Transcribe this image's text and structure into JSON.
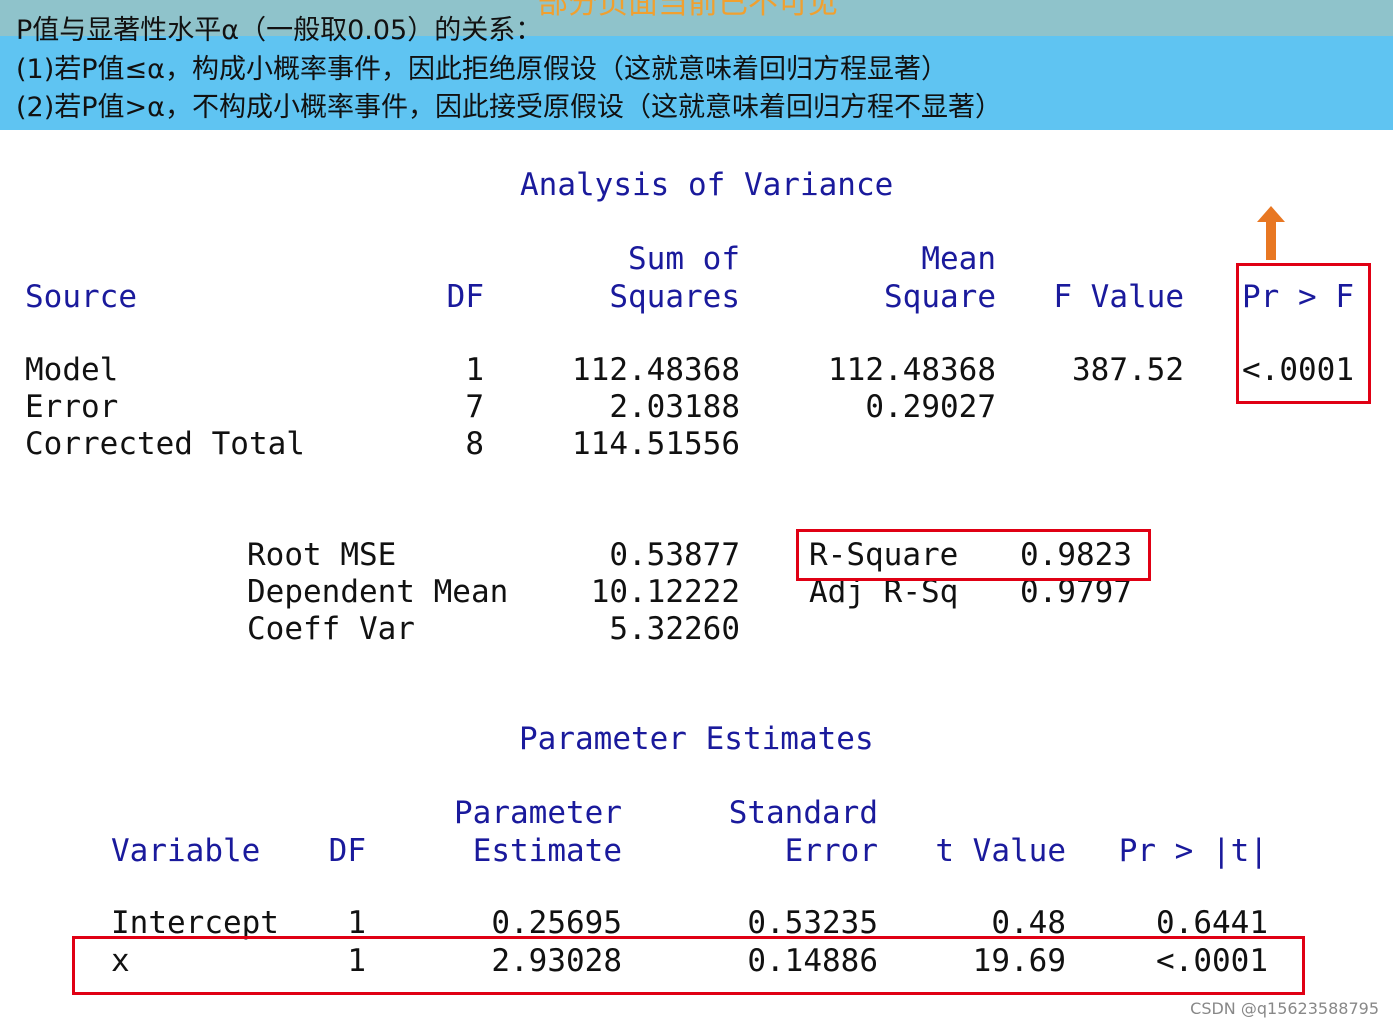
{
  "banner": {
    "clipped_heading": "部分页面当前已不可见",
    "line1": "P值与显著性水平α（一般取0.05）的关系：",
    "line2": "(1)若P值≤α，构成小概率事件，因此拒绝原假设（这就意味着回归方程显著）",
    "line3": "(2)若P值>α，不构成小概率事件，因此接受原假设（这就意味着回归方程不显著）"
  },
  "anova": {
    "title": "Analysis of Variance",
    "headers": {
      "source": "Source",
      "df": "DF",
      "ss_top": "Sum of",
      "ss_bottom": "Squares",
      "ms_top": "Mean",
      "ms_bottom": "Square",
      "f": "F Value",
      "p": "Pr > F"
    },
    "rows": [
      {
        "source": "Model",
        "df": "1",
        "ss": "112.48368",
        "ms": "112.48368",
        "f": "387.52",
        "p": "<.0001"
      },
      {
        "source": "Error",
        "df": "7",
        "ss": "2.03188",
        "ms": "0.29027",
        "f": "",
        "p": ""
      },
      {
        "source": "Corrected Total",
        "df": "8",
        "ss": "114.51556",
        "ms": "",
        "f": "",
        "p": ""
      }
    ]
  },
  "fit": {
    "left": [
      {
        "label": "Root MSE",
        "value": "0.53877"
      },
      {
        "label": "Dependent Mean",
        "value": "10.12222"
      },
      {
        "label": "Coeff Var",
        "value": "5.32260"
      }
    ],
    "right": [
      {
        "label": "R-Square",
        "value": "0.9823"
      },
      {
        "label": "Adj R-Sq",
        "value": "0.9797"
      }
    ]
  },
  "params": {
    "title": "Parameter Estimates",
    "headers": {
      "variable": "Variable",
      "df": "DF",
      "est_top": "Parameter",
      "est_bottom": "Estimate",
      "se_top": "Standard",
      "se_bottom": "Error",
      "t": "t Value",
      "p": "Pr > |t|"
    },
    "rows": [
      {
        "variable": "Intercept",
        "df": "1",
        "est": "0.25695",
        "se": "0.53235",
        "t": "0.48",
        "p": "0.6441"
      },
      {
        "variable": "x",
        "df": "1",
        "est": "2.93028",
        "se": "0.14886",
        "t": "19.69",
        "p": "<.0001"
      }
    ]
  },
  "colors": {
    "banner": "#5fc4f2",
    "header_text": "#1a1a9c",
    "highlight": "#e00014",
    "arrow": "#e87722"
  },
  "watermark": "CSDN @q15623588795"
}
